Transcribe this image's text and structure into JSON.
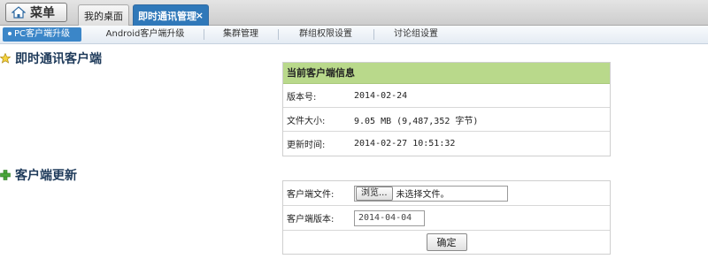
{
  "topbar": {
    "menu_label": "菜单",
    "tabs": [
      {
        "label": "我的桌面"
      },
      {
        "label": "即时通讯管理",
        "close": "×"
      }
    ]
  },
  "subnav": {
    "items": [
      {
        "label": "PC客户端升级"
      },
      {
        "label": "Android客户端升级"
      },
      {
        "label": "集群管理"
      },
      {
        "label": "群组权限设置"
      },
      {
        "label": "讨论组设置"
      }
    ]
  },
  "client_section": {
    "title": "即时通讯客户端",
    "icon": "star-icon"
  },
  "client_info": {
    "header": "当前客户端信息",
    "rows": [
      {
        "label": "版本号:",
        "value": "2014-02-24"
      },
      {
        "label": "文件大小:",
        "value": "9.05 MB (9,487,352 字节)"
      },
      {
        "label": "更新时间:",
        "value": "2014-02-27 10:51:32"
      }
    ]
  },
  "update_section": {
    "title": "客户端更新",
    "icon": "plus-icon"
  },
  "update_form": {
    "file_label": "客户端文件:",
    "browse_label": "浏览...",
    "file_status": "未选择文件。",
    "version_label": "客户端版本:",
    "version_value": "2014-04-04",
    "confirm_label": "确定"
  },
  "colors": {
    "accent": "#2f78b9",
    "subnav_active": "#3b86c8",
    "info_header": "#b9d98b"
  }
}
